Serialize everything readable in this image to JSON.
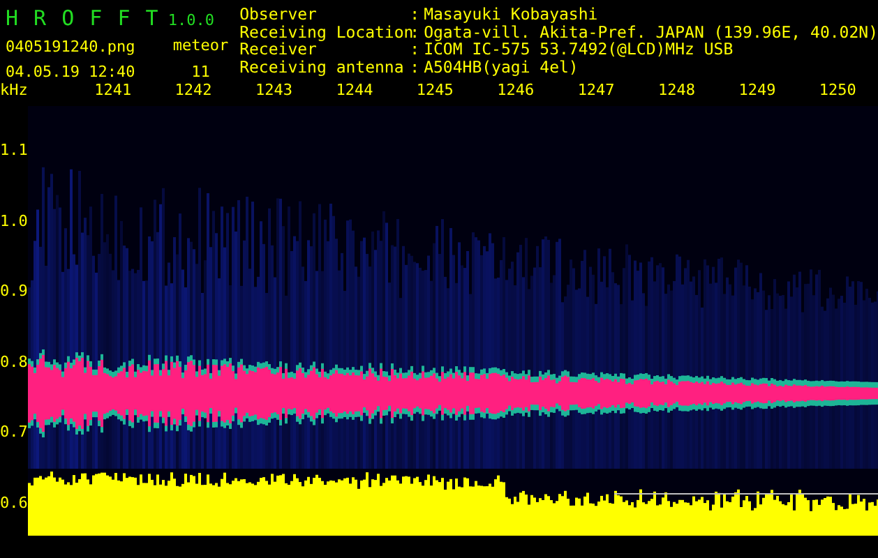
{
  "app": {
    "title": "H R O F F T",
    "version": "1.0.0",
    "filename": "0405191240.png",
    "timestamp": "04.05.19 12:40"
  },
  "counter": {
    "label": "meteor",
    "value": "11"
  },
  "info": [
    {
      "label": "Observer",
      "separator": ":",
      "value": "Masayuki Kobayashi"
    },
    {
      "label": "Receiving Location",
      "separator": ":",
      "value": "Ogata-vill. Akita-Pref. JAPAN (139.96E, 40.02N)"
    },
    {
      "label": "Receiver",
      "separator": ":",
      "value": "ICOM IC-575 53.7492(@LCD)MHz USB"
    },
    {
      "label": "Receiving antenna",
      "separator": ":",
      "value": "A504HB(yagi 4el)"
    }
  ],
  "plot": {
    "y_unit": "kHz",
    "x_ticks": [
      "1241",
      "1242",
      "1243",
      "1244",
      "1245",
      "1246",
      "1247",
      "1248",
      "1249",
      "1250"
    ],
    "y_ticks": [
      "1.1",
      "1.0",
      "0.9",
      "0.8",
      "0.7",
      "0.6"
    ]
  }
}
